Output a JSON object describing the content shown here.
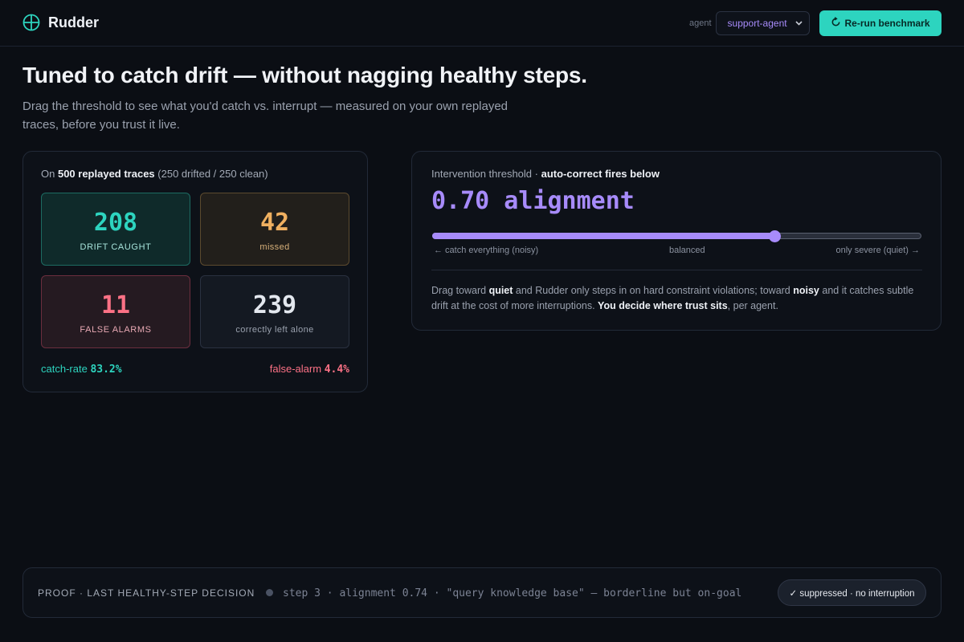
{
  "app": {
    "name": "Rudder",
    "logo_icon": "compass-icon"
  },
  "header": {
    "agent_label": "agent",
    "agent_selected": "support-agent",
    "rerun_icon": "refresh-icon",
    "rerun_label": "Re-run benchmark"
  },
  "hero": {
    "title": "Tuned to catch drift — without nagging healthy steps.",
    "subtitle": "Drag the threshold to see what you'd catch vs. interrupt — measured on your own replayed traces, before you trust it live."
  },
  "stats": {
    "prefix": "On",
    "traces": "500 replayed traces",
    "breakdown": "(250 drifted / 250 clean)",
    "tiles": [
      {
        "value": "208",
        "label": "DRIFT CAUGHT"
      },
      {
        "value": "42",
        "label": "missed"
      },
      {
        "value": "11",
        "label": "FALSE ALARMS"
      },
      {
        "value": "239",
        "label": "correctly left alone"
      }
    ],
    "catch_rate_label": "catch-rate",
    "catch_rate_value": "83.2%",
    "false_alarm_label": "false-alarm",
    "false_alarm_value": "4.4%"
  },
  "threshold": {
    "label": "Intervention threshold",
    "label_strong": "auto-correct fires below",
    "value_display": "0.70 alignment",
    "value": 0.7,
    "scale_left": "← catch everything (noisy)",
    "scale_mid": "balanced",
    "scale_right": "only severe (quiet) →",
    "desc_1": "Drag toward ",
    "desc_quiet": "quiet",
    "desc_2": " and Rudder only steps in on hard constraint violations; toward ",
    "desc_noisy": "noisy",
    "desc_3": " and it catches subtle drift at the cost of more interruptions. ",
    "desc_strong": "You decide where trust sits",
    "desc_4": ", per agent."
  },
  "proof": {
    "label": "PROOF · LAST HEALTHY-STEP DECISION",
    "detail": "step 3 · alignment 0.74 · \"query knowledge base\" — borderline but on-goal",
    "badge": "✓ suppressed · no interruption"
  },
  "colors": {
    "accent_teal": "#2dd4bf",
    "accent_purple": "#a78bfa",
    "warning_amber": "#f0b060",
    "danger_pink": "#fb7185",
    "background": "#0b0e14"
  }
}
